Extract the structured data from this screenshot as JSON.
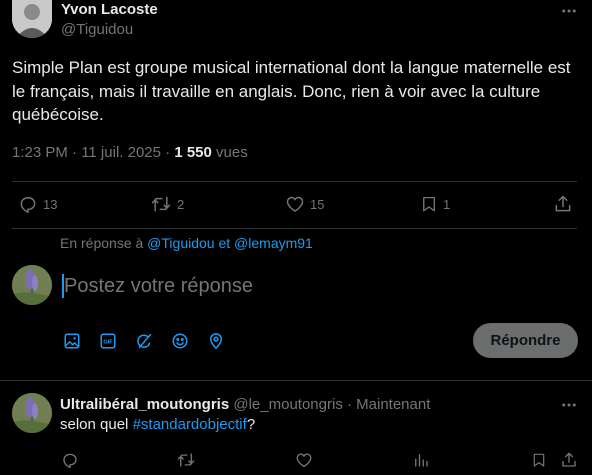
{
  "tweet": {
    "author_name": "Yvon Lacoste",
    "author_handle": "@Tiguidou",
    "text": "Simple Plan est groupe musical international dont la langue maternelle est le français, mais il travaille en anglais. Donc, rien à voir avec la culture québécoise.",
    "time": "1:23 PM · 11 juil. 2025 · ",
    "views_count": "1 550",
    "views_label": " vues",
    "replies": "13",
    "reposts": "2",
    "likes": "15",
    "bookmarks": "1"
  },
  "reply_context": {
    "prefix": "En réponse à ",
    "handle1": "@Tiguidou",
    "conjunction": " et ",
    "handle2": "@lemaym91"
  },
  "composer": {
    "placeholder": "Postez votre réponse",
    "submit_label": "Répondre"
  },
  "reply": {
    "author_name": "Ultralibéral_moutongris",
    "author_handle": " @le_moutongris",
    "time": " · Maintenant",
    "text_prefix": "selon quel ",
    "hashtag": "#standardobjectif",
    "text_suffix": "?"
  },
  "colors": {
    "background": "#000000",
    "text": "#e7e9ea",
    "muted": "#71767b",
    "accent": "#1d9bf0",
    "divider": "#2f3336"
  },
  "icons": {
    "more": "more-horizontal-icon",
    "reply": "reply-bubble-icon",
    "repost": "repost-icon",
    "like": "heart-icon",
    "bookmark": "bookmark-icon",
    "share": "share-icon",
    "media": "image-icon",
    "gif": "gif-icon",
    "grok": "grok-icon",
    "emoji": "emoji-icon",
    "location": "location-pin-icon",
    "views": "views-chart-icon"
  }
}
